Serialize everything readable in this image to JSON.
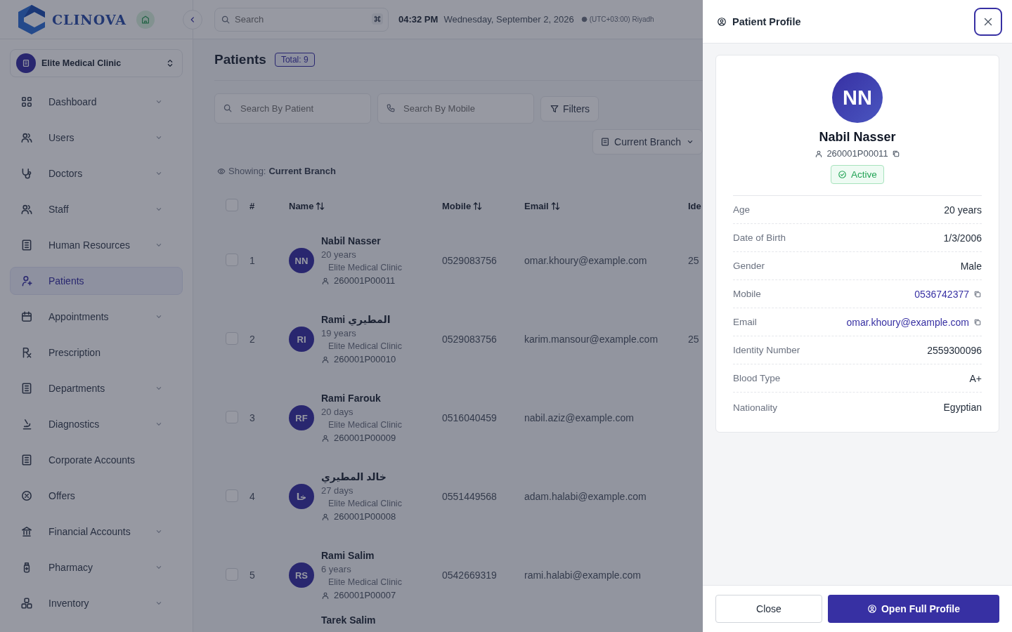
{
  "header": {
    "logo": "CLINOVA",
    "search": {
      "placeholder": "Search"
    },
    "time": "04:32 PM",
    "date": "Wednesday, September 2, 2026",
    "timezone": "(UTC+03:00) Riyadh"
  },
  "sidebar": {
    "clinic": "Elite Medical Clinic",
    "items": [
      {
        "label": "Dashboard",
        "has_submenu": true,
        "selected": false
      },
      {
        "label": "Users",
        "has_submenu": true,
        "selected": false
      },
      {
        "label": "Doctors",
        "has_submenu": true,
        "selected": false
      },
      {
        "label": "Staff",
        "has_submenu": true,
        "selected": false
      },
      {
        "label": "Human Resources",
        "has_submenu": true,
        "selected": false
      },
      {
        "label": "Patients",
        "has_submenu": false,
        "selected": true
      },
      {
        "label": "Appointments",
        "has_submenu": true,
        "selected": false
      },
      {
        "label": "Prescription",
        "has_submenu": false,
        "selected": false
      },
      {
        "label": "Departments",
        "has_submenu": true,
        "selected": false
      },
      {
        "label": "Diagnostics",
        "has_submenu": true,
        "selected": false
      },
      {
        "label": "Corporate Accounts",
        "has_submenu": false,
        "selected": false
      },
      {
        "label": "Offers",
        "has_submenu": false,
        "selected": false
      },
      {
        "label": "Financial Accounts",
        "has_submenu": true,
        "selected": false
      },
      {
        "label": "Pharmacy",
        "has_submenu": true,
        "selected": false
      },
      {
        "label": "Inventory",
        "has_submenu": true,
        "selected": false
      }
    ]
  },
  "page": {
    "title": "Patients",
    "total": "Total: 9",
    "patient_search": {
      "placeholder": "Search By Patient"
    },
    "mobile_search": {
      "placeholder": "Search By Mobile"
    },
    "filters": "Filters",
    "branch": "Current Branch",
    "showing_label": "Showing:",
    "showing_value": "Current Branch"
  },
  "table": {
    "all_checked": false,
    "columns": [
      "#",
      "Name",
      "Mobile",
      "Email",
      "Ide"
    ],
    "rows": [
      {
        "index": "1",
        "initials": "NN",
        "name": "Nabil Nasser",
        "age": "20 years",
        "clinic": "Elite Medical Clinic",
        "file_no": "260001P00011",
        "mobile": "0529083756",
        "email": "omar.khoury@example.com",
        "identity": "25",
        "checked": false
      },
      {
        "index": "2",
        "initials": "RI",
        "name": "Rami المطيري",
        "age": "19 years",
        "clinic": "Elite Medical Clinic",
        "file_no": "260001P00010",
        "mobile": "0529083756",
        "email": "karim.mansour@example.com",
        "identity": "25",
        "checked": false
      },
      {
        "index": "3",
        "initials": "RF",
        "name": "Rami Farouk",
        "age": "20 days",
        "clinic": "Elite Medical Clinic",
        "file_no": "260001P00009",
        "mobile": "0516040459",
        "email": "nabil.aziz@example.com",
        "checked": false
      },
      {
        "index": "4",
        "initials": "خا",
        "name": "خالد المطيري",
        "age": "27 days",
        "clinic": "Elite Medical Clinic",
        "file_no": "260001P00008",
        "mobile": "0551449568",
        "email": "adam.halabi@example.com",
        "checked": false
      },
      {
        "index": "5",
        "initials": "RS",
        "name": "Rami Salim",
        "age": "6 years",
        "clinic": "Elite Medical Clinic",
        "file_no": "260001P00007",
        "mobile": "0542669319",
        "email": "rami.halabi@example.com",
        "checked": false
      },
      {
        "name": "Tarek Salim"
      }
    ]
  },
  "drawer": {
    "title": "Patient Profile",
    "initials": "NN",
    "name": "Nabil Nasser",
    "file_no": "260001P00011",
    "status": "Active",
    "fields": [
      {
        "label": "Age",
        "value": "20 years",
        "kind": "text"
      },
      {
        "label": "Date of Birth",
        "value": "1/3/2006",
        "kind": "text"
      },
      {
        "label": "Gender",
        "value": "Male",
        "kind": "text"
      },
      {
        "label": "Mobile",
        "value": "0536742377",
        "kind": "link"
      },
      {
        "label": "Email",
        "value": "omar.khoury@example.com",
        "kind": "link"
      },
      {
        "label": "Identity Number",
        "value": "2559300096",
        "kind": "text"
      },
      {
        "label": "Blood Type",
        "value": "A+",
        "kind": "text"
      },
      {
        "label": "Nationality",
        "value": "Egyptian",
        "kind": "text"
      }
    ],
    "buttons": [
      "Close",
      "Open Full Profile"
    ]
  }
}
